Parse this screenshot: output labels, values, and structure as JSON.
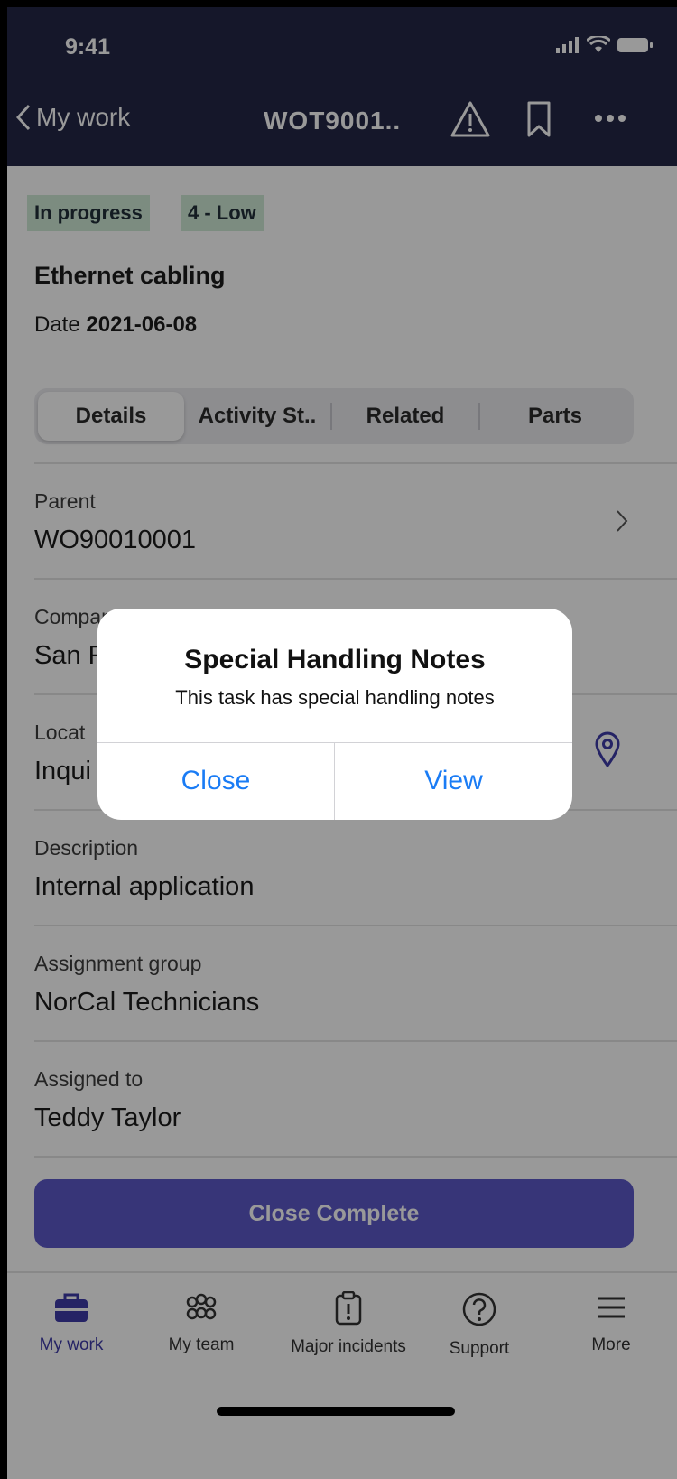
{
  "status_bar": {
    "time": "9:41"
  },
  "header": {
    "back_label": "My work",
    "title": "WOT9001.."
  },
  "badges": {
    "state": "In progress",
    "priority": "4 - Low"
  },
  "task": {
    "title": "Ethernet cabling",
    "date_label": "Date",
    "date_value": "2021-06-08"
  },
  "tabs": [
    {
      "label": "Details"
    },
    {
      "label": "Activity St.."
    },
    {
      "label": "Related"
    },
    {
      "label": "Parts"
    }
  ],
  "fields": [
    {
      "label": "Parent",
      "value": "WO90010001"
    },
    {
      "label": "Company",
      "value": "San F"
    },
    {
      "label": "Locat",
      "value": "Inqui"
    },
    {
      "label": "Description",
      "value": "Internal application"
    },
    {
      "label": "Assignment group",
      "value": "NorCal Technicians"
    },
    {
      "label": "Assigned to",
      "value": "Teddy Taylor"
    }
  ],
  "primary_action": "Close Complete",
  "bottom_nav": [
    {
      "label": "My work",
      "icon": "briefcase-icon",
      "active": true
    },
    {
      "label": "My team",
      "icon": "team-icon"
    },
    {
      "label": "Major incidents",
      "icon": "clipboard-alert-icon"
    },
    {
      "label": "Support",
      "icon": "help-circle-icon"
    },
    {
      "label": "More",
      "icon": "menu-icon"
    }
  ],
  "alert": {
    "title": "Special Handling Notes",
    "message": "This task has special handling notes",
    "close_label": "Close",
    "view_label": "View"
  },
  "colors": {
    "header_bg": "#232746",
    "badge_bg": "#cfead6",
    "primary_button": "#5c59c9",
    "link_blue": "#1a7cf5",
    "nav_active": "#3e3ba8"
  }
}
